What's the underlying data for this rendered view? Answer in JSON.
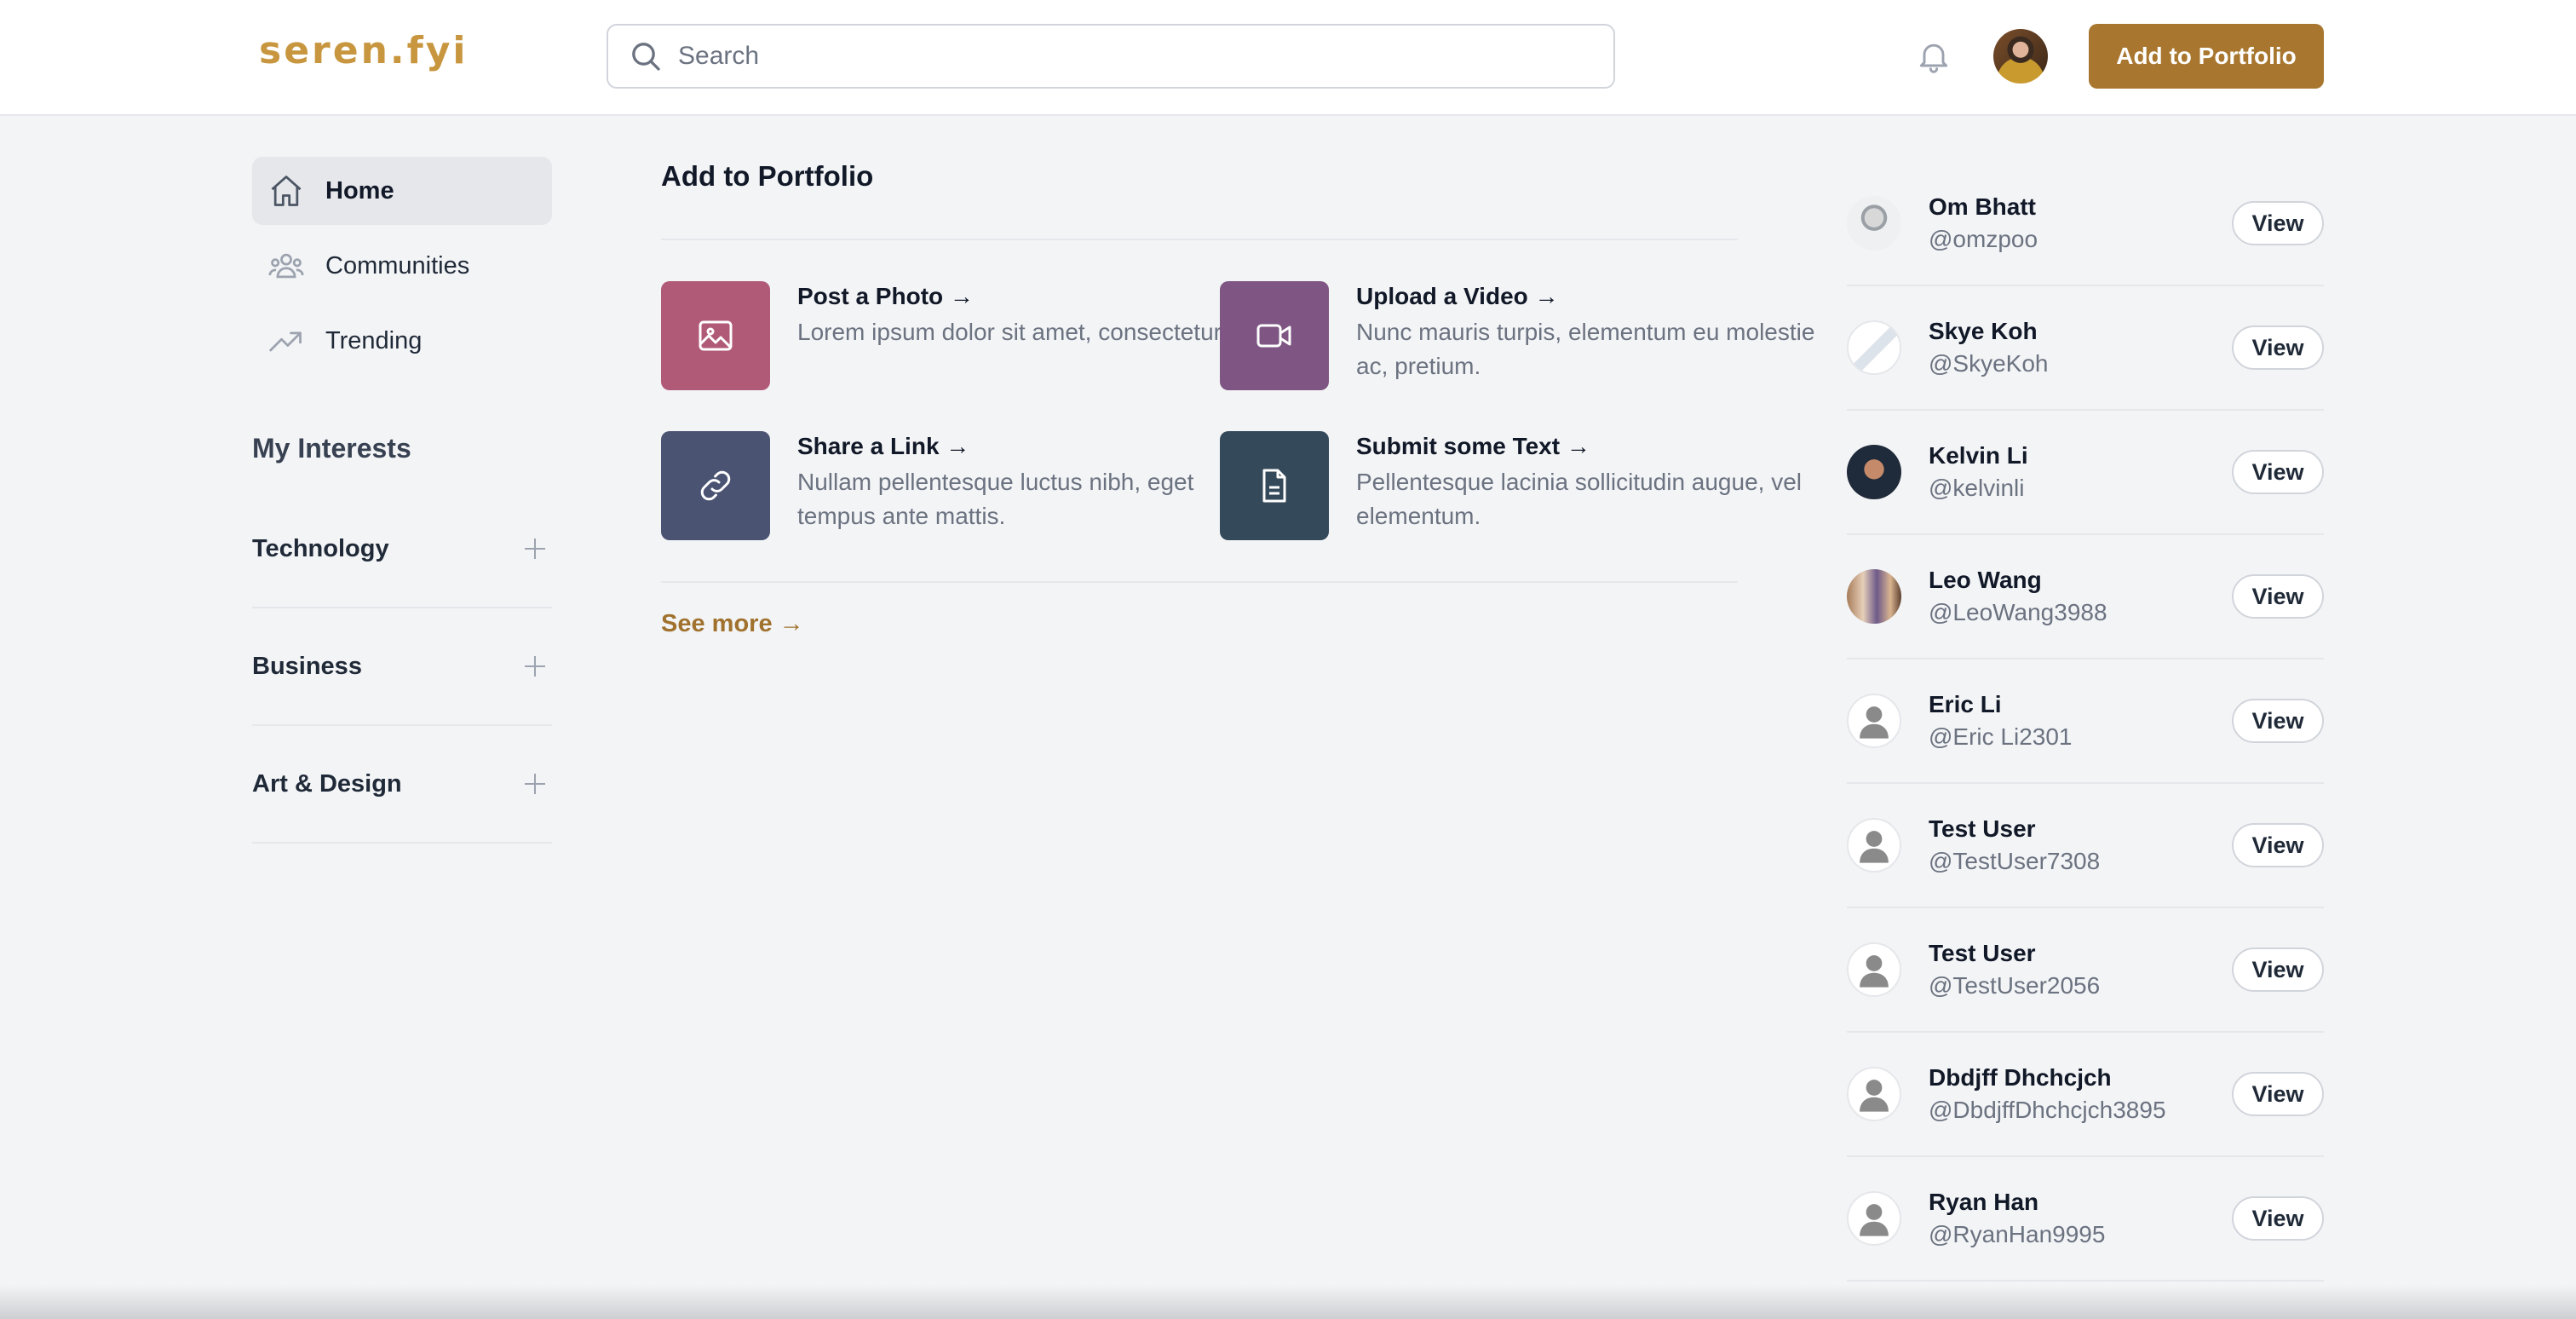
{
  "header": {
    "logo": "seren.fyi",
    "search_placeholder": "Search",
    "primary_button": "Add to Portfolio"
  },
  "sidebar": {
    "nav": [
      {
        "label": "Home",
        "icon": "home-icon",
        "active": true
      },
      {
        "label": "Communities",
        "icon": "users-icon",
        "active": false
      },
      {
        "label": "Trending",
        "icon": "trending-icon",
        "active": false
      }
    ],
    "interests_title": "My Interests",
    "interests": [
      "Technology",
      "Business",
      "Art & Design"
    ]
  },
  "main": {
    "title": "Add to Portfolio",
    "actions": [
      {
        "title": "Post a Photo →",
        "desc": "Lorem ipsum dolor sit amet, consectetur elit.",
        "icon": "photo-icon",
        "color": "#b05a78"
      },
      {
        "title": "Upload a Video →",
        "desc": "Nunc mauris turpis, elementum eu molestie ac, pretium.",
        "icon": "video-icon",
        "color": "#7e5583"
      },
      {
        "title": "Share a Link →",
        "desc": "Nullam pellentesque luctus nibh, eget tempus ante mattis.",
        "icon": "link-icon",
        "color": "#4b5373"
      },
      {
        "title": "Submit some Text →",
        "desc": "Pellentesque lacinia sollicitudin augue, vel elementum.",
        "icon": "document-icon",
        "color": "#34495a"
      }
    ],
    "see_more": "See more →"
  },
  "users": [
    {
      "name": "Om Bhatt",
      "handle": "@omzpoo",
      "view": "View"
    },
    {
      "name": "Skye Koh",
      "handle": "@SkyeKoh",
      "view": "View"
    },
    {
      "name": "Kelvin Li",
      "handle": "@kelvinli",
      "view": "View"
    },
    {
      "name": "Leo Wang",
      "handle": "@LeoWang3988",
      "view": "View"
    },
    {
      "name": "Eric Li",
      "handle": "@Eric Li2301",
      "view": "View"
    },
    {
      "name": "Test User",
      "handle": "@TestUser7308",
      "view": "View"
    },
    {
      "name": "Test User",
      "handle": "@TestUser2056",
      "view": "View"
    },
    {
      "name": "Dbdjff Dhchcjch",
      "handle": "@DbdjffDhchcjch3895",
      "view": "View"
    },
    {
      "name": "Ryan Han",
      "handle": "@RyanHan9995",
      "view": "View"
    }
  ],
  "colors": {
    "brand": "#a8762e",
    "logo": "#c8963e",
    "link": "#a0722e"
  }
}
